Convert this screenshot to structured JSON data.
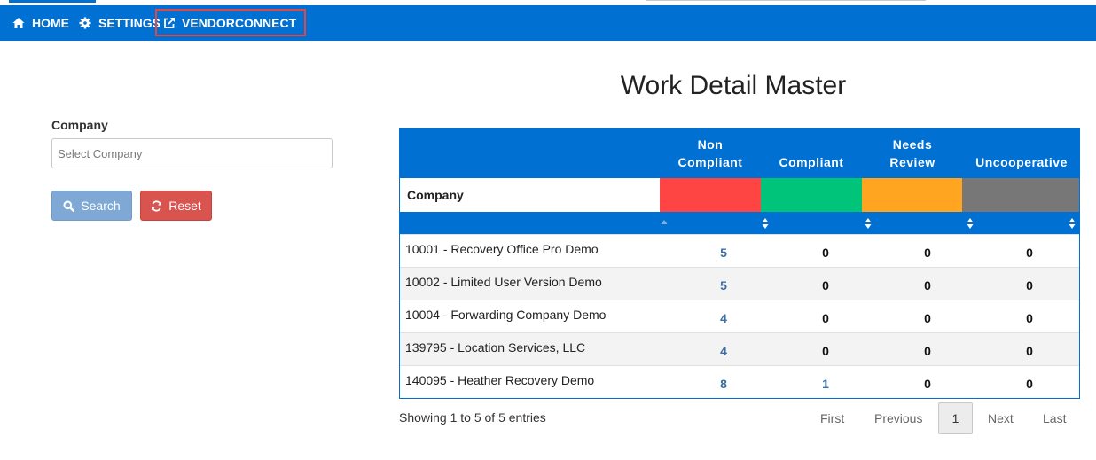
{
  "nav": {
    "home": "HOME",
    "settings": "SETTINGS",
    "vendorconnect": "VENDORCONNECT"
  },
  "page": {
    "title": "Work Detail Master"
  },
  "filters": {
    "company_label": "Company",
    "company_placeholder": "Select Company",
    "search_label": "Search",
    "reset_label": "Reset"
  },
  "table": {
    "columns": [
      {
        "line1": "Non",
        "line2": "Compliant"
      },
      {
        "line1": "",
        "line2": "Compliant"
      },
      {
        "line1": "Needs",
        "line2": "Review"
      },
      {
        "line1": "",
        "line2": "Uncooperative"
      }
    ],
    "company_header": "Company",
    "status_colors": [
      "#ff4444",
      "#00c47a",
      "#ffa51f",
      "#777777"
    ],
    "rows": [
      {
        "company": "10001 - Recovery Office Pro Demo",
        "non_compliant": "5",
        "compliant": "0",
        "needs_review": "0",
        "uncooperative": "0"
      },
      {
        "company": "10002 - Limited User Version Demo",
        "non_compliant": "5",
        "compliant": "0",
        "needs_review": "0",
        "uncooperative": "0"
      },
      {
        "company": "10004 - Forwarding Company Demo",
        "non_compliant": "4",
        "compliant": "0",
        "needs_review": "0",
        "uncooperative": "0"
      },
      {
        "company": "139795 - Location Services, LLC",
        "non_compliant": "4",
        "compliant": "0",
        "needs_review": "0",
        "uncooperative": "0"
      },
      {
        "company": "140095 - Heather Recovery Demo",
        "non_compliant": "8",
        "compliant": "1",
        "needs_review": "0",
        "uncooperative": "0"
      }
    ]
  },
  "pagination": {
    "info": "Showing 1 to 5 of 5 entries",
    "first": "First",
    "previous": "Previous",
    "current": "1",
    "next": "Next",
    "last": "Last"
  }
}
